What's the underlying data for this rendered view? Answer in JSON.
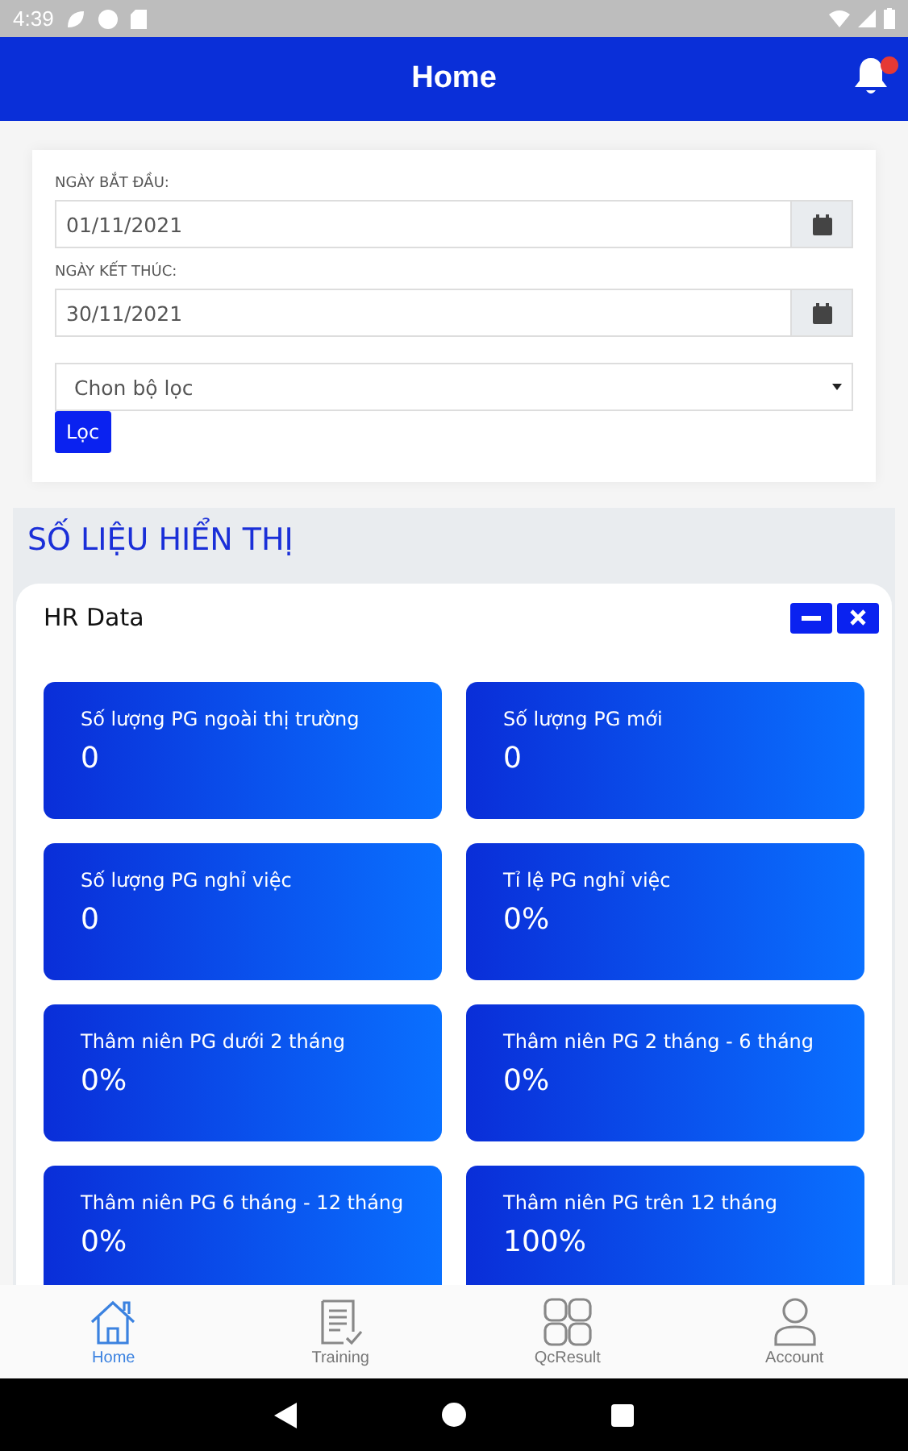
{
  "status_bar": {
    "time": "4:39"
  },
  "app_bar": {
    "title": "Home",
    "notification_badge": true
  },
  "filter": {
    "start_label": "NGÀY BẮT ĐẦU:",
    "start_value": "01/11/2021",
    "end_label": "NGÀY KẾT THÚC:",
    "end_value": "30/11/2021",
    "select_placeholder": "Chon bộ lọc",
    "button": "Lọc"
  },
  "section": {
    "title": "SỐ LIỆU HIỂN THỊ"
  },
  "panel": {
    "title": "HR Data"
  },
  "stats": [
    {
      "label": "Số lượng PG ngoài thị trường",
      "value": "0"
    },
    {
      "label": "Số lượng PG mới",
      "value": "0"
    },
    {
      "label": "Số lượng PG nghỉ việc",
      "value": "0"
    },
    {
      "label": "Tỉ lệ PG nghỉ việc",
      "value": "0%"
    },
    {
      "label": "Thâm niên PG dưới 2 tháng",
      "value": "0%"
    },
    {
      "label": "Thâm niên PG 2 tháng - 6 tháng",
      "value": "0%"
    },
    {
      "label": "Thâm niên PG 6 tháng - 12 tháng",
      "value": "0%"
    },
    {
      "label": "Thâm niên PG trên 12 tháng",
      "value": "100%"
    }
  ],
  "bottom_nav": [
    {
      "label": "Home",
      "kind": "home",
      "selected": true
    },
    {
      "label": "Training",
      "kind": "training",
      "selected": false
    },
    {
      "label": "QcResult",
      "kind": "grid",
      "selected": false
    },
    {
      "label": "Account",
      "kind": "account",
      "selected": false
    }
  ]
}
